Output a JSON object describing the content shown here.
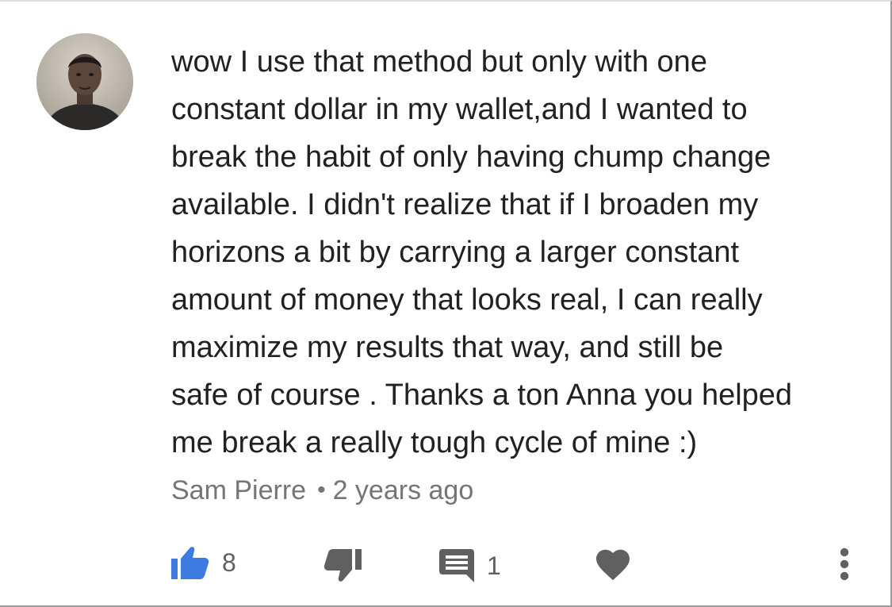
{
  "comment": {
    "text": "wow I use that method but only with one\nconstant dollar in my wallet,and I wanted to\nbreak the habit of only having chump change\navailable. I didn't realize that if I broaden my\nhorizons a bit by carrying a larger constant\namount of money that looks real, I can really\nmaximize my results that way, and still be\nsafe of course . Thanks a ton Anna you helped\nme break a really tough cycle of mine :)",
    "author": "Sam Pierre",
    "separator": "•",
    "time": "2 years ago"
  },
  "actions": {
    "like_count": "8",
    "reply_count": "1"
  },
  "colors": {
    "like_active": "#3d7be0",
    "icon_default": "#606060",
    "text_primary": "#212121",
    "text_secondary": "#757575"
  },
  "icons": {
    "like": "thumbs-up-icon",
    "dislike": "thumbs-down-icon",
    "reply": "comment-icon",
    "heart": "heart-icon",
    "more": "more-vertical-icon"
  }
}
